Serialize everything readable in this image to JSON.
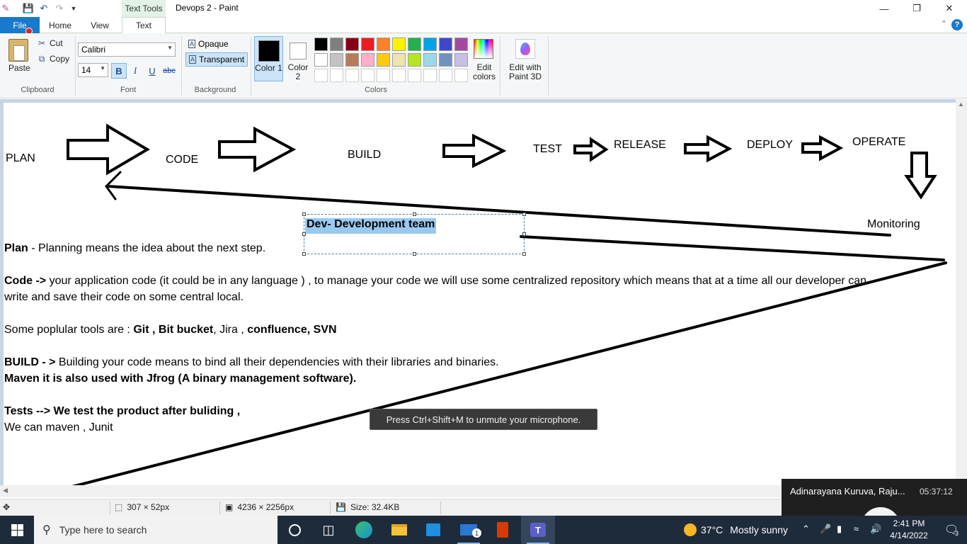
{
  "window": {
    "title": "Devops 2 - Paint",
    "context_tab": "Text Tools",
    "minimize": "—",
    "maximize": "❐",
    "close": "✕"
  },
  "tabs": {
    "file": "File",
    "home": "Home",
    "view": "View",
    "text": "Text"
  },
  "ribbon": {
    "clipboard": {
      "paste": "Paste",
      "cut": "Cut",
      "copy": "Copy",
      "label": "Clipboard"
    },
    "font": {
      "family": "Calibri",
      "size": "14",
      "bold": "B",
      "italic": "I",
      "underline": "U",
      "strike": "abc",
      "label": "Font"
    },
    "background": {
      "opaque": "Opaque",
      "transparent": "Transparent",
      "label": "Background"
    },
    "colors": {
      "color1": "Color 1",
      "color2": "Color 2",
      "label": "Colors",
      "edit_colors": "Edit colors",
      "color1_value": "#000000",
      "color2_value": "#ffffff",
      "palette": [
        [
          "#000000",
          "#7f7f7f",
          "#880015",
          "#ed1c24",
          "#ff7f27",
          "#fff200",
          "#22b14c",
          "#00a2e8",
          "#3f48cc",
          "#a349a4"
        ],
        [
          "#ffffff",
          "#c3c3c3",
          "#b97a57",
          "#ffaec9",
          "#ffc90e",
          "#efe4b0",
          "#b5e61d",
          "#99d9ea",
          "#7092be",
          "#c8bfe7"
        ],
        [
          "#ffffff",
          "#ffffff",
          "#ffffff",
          "#ffffff",
          "#ffffff",
          "#ffffff",
          "#ffffff",
          "#ffffff",
          "#ffffff",
          "#ffffff"
        ]
      ]
    },
    "paint3d": "Edit with Paint 3D"
  },
  "canvas": {
    "flow": [
      "PLAN",
      "CODE",
      "BUILD",
      "TEST",
      "RELEASE",
      "DEPLOY",
      "OPERATE"
    ],
    "monitoring": "Monitoring",
    "selected_text": "Dev- Development team",
    "plan_bold": "Plan",
    "plan_rest": " - Planning means the idea about the next step.",
    "code_bold": "Code ->",
    "code_rest": " your application code (it could be in any language ) , to manage your code we will use some centralized repository which means that at a time all our developer can",
    "code_line2": "write and save their code on some central local.",
    "tools_prefix": "Some poplular tools are : ",
    "tools_bold1": "Git , Bit bucket",
    "tools_mid": ", Jira , ",
    "tools_bold2": "confluence, SVN",
    "build_bold": "BUILD - >",
    "build_rest": " Building your code means to bind all their dependencies with their libraries and binaries.",
    "maven_line": "Maven  it is also used with Jfrog (A binary management software).",
    "tests_line": "Tests --> We test the product after buliding ,",
    "maven_junit": "We can maven , Junit"
  },
  "toast": "Press Ctrl+Shift+M to unmute your microphone.",
  "status": {
    "selection_size": "307 × 52px",
    "image_size": "4236 × 2256px",
    "file_size": "Size: 32.4KB"
  },
  "teams_call": {
    "caller": "Adinarayana Kuruva, Raju...",
    "duration": "05:37:12"
  },
  "taskbar": {
    "search_placeholder": "Type here to search",
    "mail_badge": "1",
    "weather_temp": "37°C",
    "weather_desc": "Mostly sunny",
    "time": "2:41 PM",
    "date": "4/14/2022",
    "notification_count": "3"
  }
}
